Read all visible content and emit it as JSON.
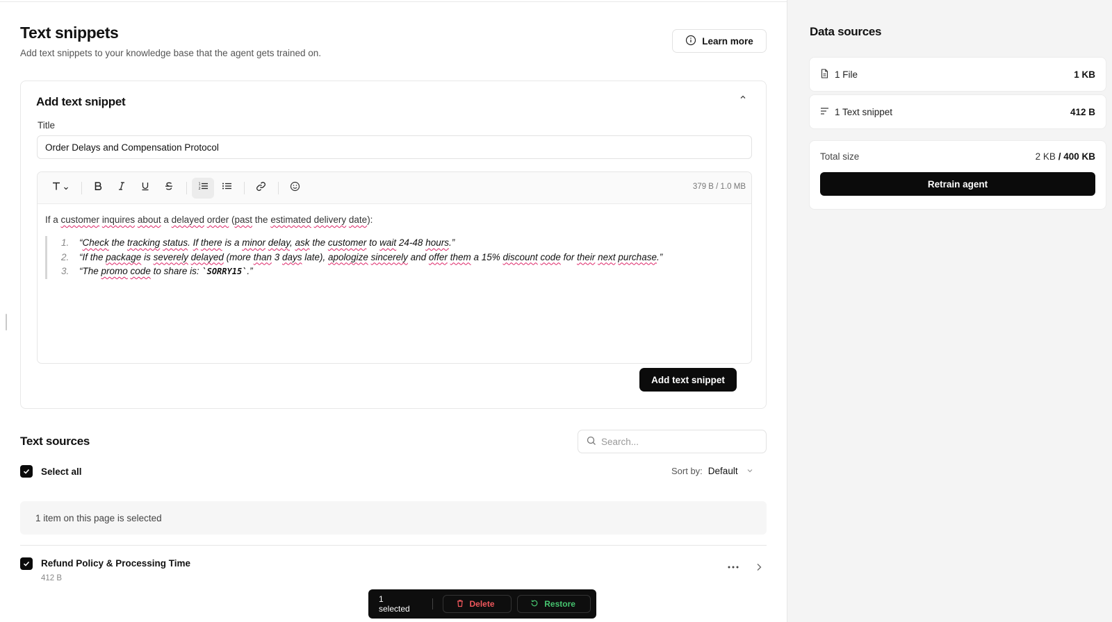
{
  "page": {
    "title": "Text snippets",
    "subtitle": "Add text snippets to your knowledge base that the agent gets trained on.",
    "learn_more_label": "Learn more"
  },
  "add_snippet": {
    "heading": "Add text snippet",
    "title_label": "Title",
    "title_value": "Order Delays and Compensation Protocol",
    "size_indicator": "379 B / 1.0 MB",
    "add_button_label": "Add text snippet",
    "toolbar_icons": [
      "text-style-icon",
      "bold-icon",
      "italic-icon",
      "underline-icon",
      "strikethrough-icon",
      "ordered-list-icon",
      "bullet-list-icon",
      "link-icon",
      "emoji-icon"
    ],
    "body": {
      "intro_parts": [
        "If a ",
        "customer",
        " ",
        "inquires",
        " ",
        "about",
        " a ",
        "delayed",
        " ",
        "order",
        " (",
        "past",
        " the ",
        "estimated",
        " ",
        "delivery",
        " ",
        "date",
        "):"
      ],
      "items": [
        {
          "number": "1.",
          "parts": [
            "“",
            "Check",
            " the ",
            "tracking",
            " ",
            "status",
            ". ",
            "If",
            " ",
            "there",
            " is a ",
            "minor",
            " ",
            "delay",
            ", ",
            "ask",
            " the ",
            "customer",
            " to ",
            "wait",
            " 24-48 ",
            "hours",
            ".”"
          ]
        },
        {
          "number": "2.",
          "parts": [
            "“If the ",
            "package",
            " is ",
            "severely",
            " ",
            "delayed",
            " (more ",
            "than",
            " 3 ",
            "days",
            " late), ",
            "apologize",
            " ",
            "sincerely",
            " and ",
            "offer",
            " ",
            "them",
            " a 15% ",
            "discount",
            " ",
            "code",
            " for ",
            "their",
            " ",
            "next",
            " ",
            "purchase",
            ".”"
          ]
        },
        {
          "number": "3.",
          "parts": [
            "“The ",
            "promo",
            " ",
            "code",
            " to share is: ",
            "`SORRY15`",
            ".”"
          ]
        }
      ]
    }
  },
  "text_sources": {
    "heading": "Text sources",
    "search_placeholder": "Search...",
    "select_all_label": "Select all",
    "sort_label": "Sort by:",
    "sort_value": "Default",
    "selection_notice": "1 item on this page is selected",
    "items": [
      {
        "name": "Refund Policy & Processing Time",
        "size": "412 B",
        "checked": true
      }
    ]
  },
  "bulk_bar": {
    "count_label": "1 selected",
    "delete_label": "Delete",
    "restore_label": "Restore"
  },
  "data_sources": {
    "heading": "Data sources",
    "rows": [
      {
        "icon": "file-icon",
        "label": "1 File",
        "size": "1 KB"
      },
      {
        "icon": "text-lines-icon",
        "label": "1 Text snippet",
        "size": "412 B"
      }
    ],
    "total_label": "Total size",
    "total_used": "2 KB",
    "total_sep": " / ",
    "total_limit": "400 KB",
    "retrain_label": "Retrain agent"
  },
  "colors": {
    "primary_button": "#0b0b0b",
    "delete": "#f0575c",
    "restore": "#46c46f",
    "sidebar_bg": "#f4f4f4"
  }
}
